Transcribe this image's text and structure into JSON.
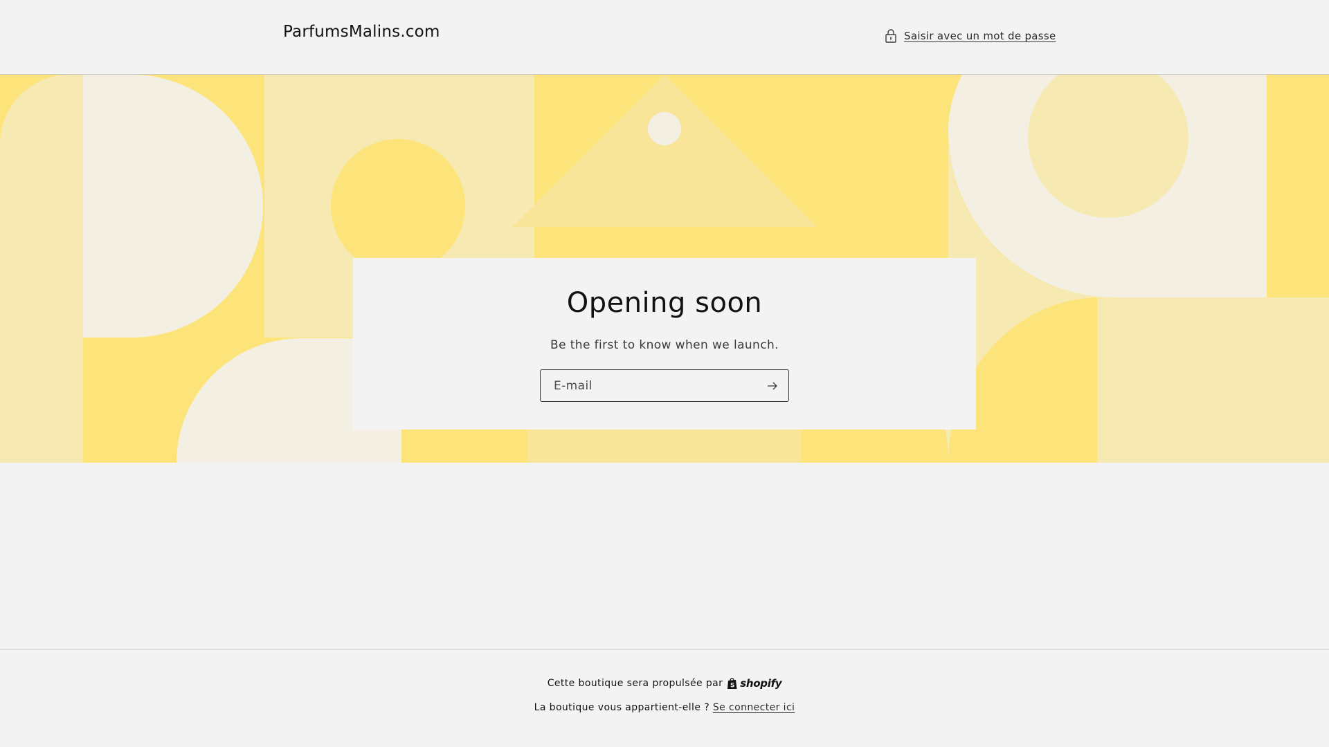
{
  "header": {
    "brand": "ParfumsMalins.com",
    "password_link": {
      "label": "Saisir avec un mot de passe",
      "icon": "lock-icon"
    }
  },
  "hero": {
    "colors": {
      "yellow": "#fde47a",
      "pale_yellow": "#f6e9b2",
      "cream": "#f3f0e3",
      "light_yellow": "#f8e599"
    }
  },
  "signup": {
    "title": "Opening soon",
    "subtitle": "Be the first to know when we launch.",
    "email_placeholder": "E-mail",
    "submit_icon": "arrow-right-icon"
  },
  "footer": {
    "powered_by": "Cette boutique sera propulsée par",
    "shopify_wordmark": "shopify",
    "owner_question": "La boutique vous appartient-elle ?",
    "login_link": "Se connecter ici"
  }
}
